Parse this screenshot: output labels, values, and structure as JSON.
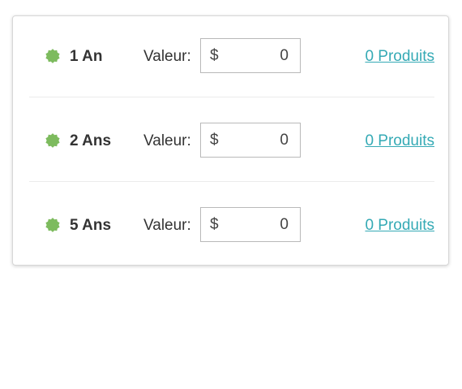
{
  "colors": {
    "badge": "#7dbb5e",
    "link": "#35aab5",
    "text": "#333333",
    "border": "#b9b9b9"
  },
  "rows": [
    {
      "term": "1 An",
      "value_label": "Valeur:",
      "currency": "$",
      "amount": "0",
      "products_link": "0 Produits",
      "badge_icon": "green-badge-icon"
    },
    {
      "term": "2 Ans",
      "value_label": "Valeur:",
      "currency": "$",
      "amount": "0",
      "products_link": "0 Produits",
      "badge_icon": "green-badge-icon"
    },
    {
      "term": "5 Ans",
      "value_label": "Valeur:",
      "currency": "$",
      "amount": "0",
      "products_link": "0 Produits",
      "badge_icon": "green-badge-icon"
    }
  ]
}
